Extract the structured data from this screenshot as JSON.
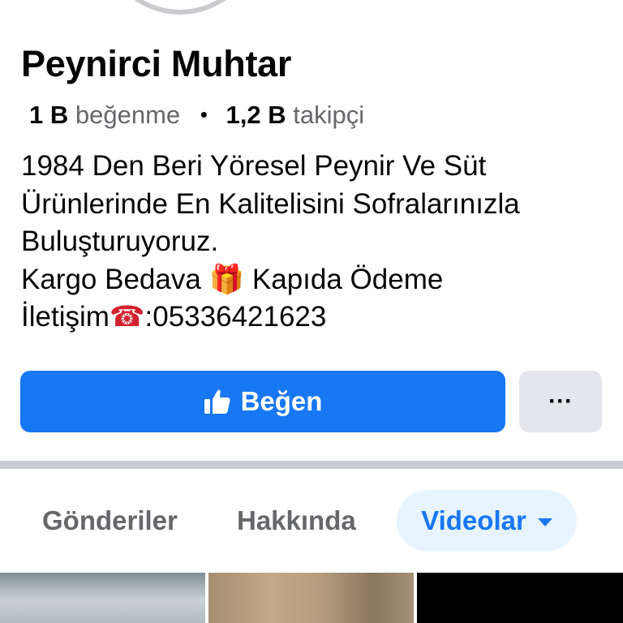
{
  "page": {
    "name": "Peynirci Muhtar",
    "likes_count": "1 B",
    "likes_label": "beğenme",
    "separator_dot": "•",
    "followers_count": "1,2 B",
    "followers_label": "takipçi"
  },
  "bio": {
    "line1": "1984 Den Beri Yöresel Peynir Ve Süt",
    "line2": "Ürünlerinde En Kalitelisini Sofralarınızla",
    "line3": "Buluşturuyoruz.",
    "line4_part1": "Kargo Bedava ",
    "line4_emoji": "🎁",
    "line4_part2": " Kapıda Ödeme",
    "line5_part1": "İletişim",
    "line5_emoji": "☎",
    "line5_part2": ":05336421623"
  },
  "actions": {
    "like_label": "Beğen",
    "more_label": "···"
  },
  "tabs": [
    {
      "label": "Gönderiler",
      "active": false
    },
    {
      "label": "Hakkında",
      "active": false
    },
    {
      "label": "Videolar",
      "active": true
    }
  ],
  "colors": {
    "brand_blue": "#1877f2",
    "active_tab_bg": "#e7f3ff",
    "secondary_button_bg": "#e4e6eb",
    "muted_text": "#65676b"
  },
  "icons": {
    "like": "thumbs-up-icon",
    "tab_dropdown": "caret-down-icon"
  }
}
